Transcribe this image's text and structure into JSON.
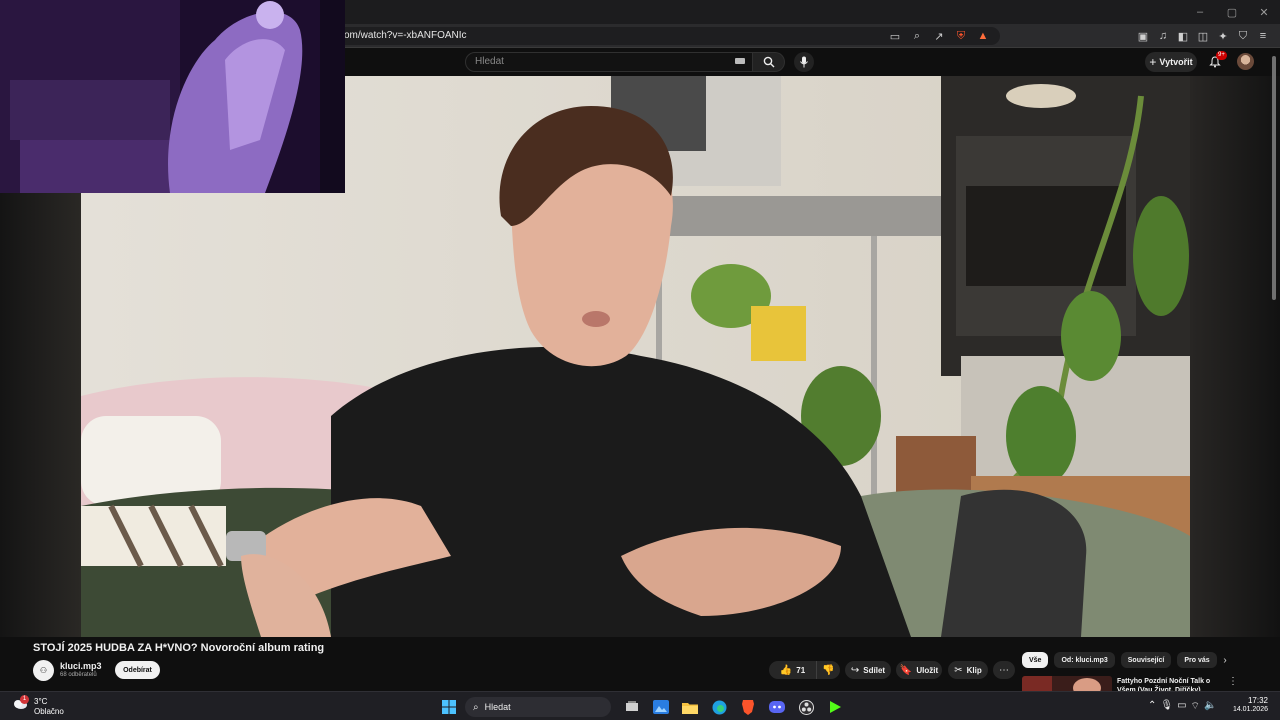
{
  "browser": {
    "url": "om/watch?v=-xbANFOANIc",
    "window_controls": [
      "–",
      "▢",
      "✕"
    ],
    "badges": {
      "brave_shields": "16",
      "notification": "3"
    }
  },
  "youtube_header": {
    "search_placeholder": "Hledat",
    "create_label": "Vytvořit",
    "notifications_badge": "9+"
  },
  "video": {
    "title": "STOJÍ 2025 HUDBA ZA H*VNO? Novoroční album rating",
    "channel_name": "kluci.mp3",
    "subscribers": "68 odběratelů",
    "subscribe_label": "Odebírat",
    "like_count": "71",
    "share_label": "Sdílet",
    "save_label": "Uložit",
    "clip_label": "Klip"
  },
  "sidebar": {
    "chips": [
      "Vše",
      "Od: kluci.mp3",
      "Související",
      "Pro vás"
    ],
    "active_chip": "Vše",
    "recommended_title": "Fattyho Pozdní Noční Talk o Všem (Vau Život, Diříčky)"
  },
  "taskbar": {
    "temperature": "3°C",
    "condition": "Oblačno",
    "weather_badge": "1",
    "search_label": "Hledat",
    "time": "17:32",
    "date": "14.01.2026"
  },
  "colors": {
    "accent_red": "#cc0000",
    "background": "#0f0f0f",
    "chip_bg": "#272727"
  }
}
